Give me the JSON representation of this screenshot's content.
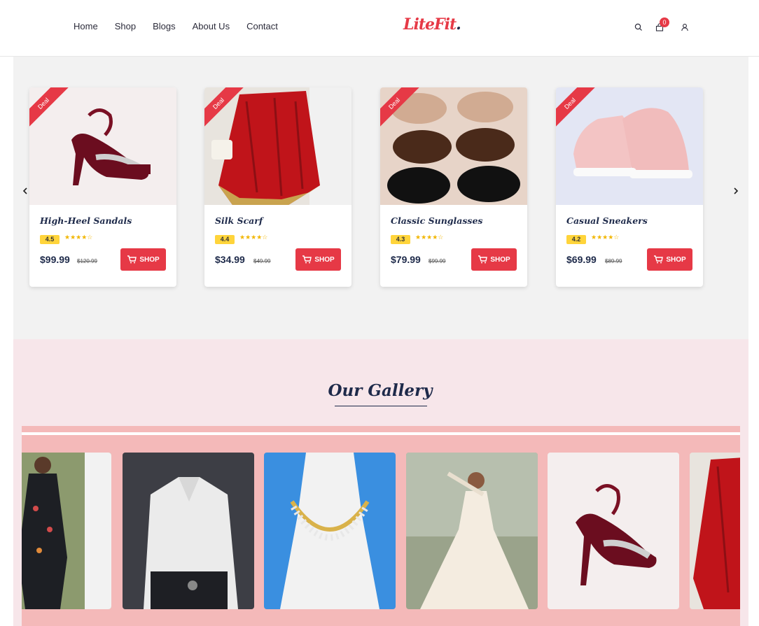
{
  "nav": {
    "items": [
      "Home",
      "Shop",
      "Blogs",
      "About Us",
      "Contact"
    ]
  },
  "logo": {
    "text": "LiteFit",
    "dot": "."
  },
  "header_icons": [
    "search-icon",
    "cart-icon",
    "user-icon"
  ],
  "cart": {
    "count": "0"
  },
  "products": [
    {
      "name": "High-Heel Sandals",
      "rating": "4.5",
      "stars": "★★★★☆",
      "price": "$99.99",
      "old_price": "$120.99",
      "ribbon": "Deal",
      "button": "SHOP"
    },
    {
      "name": "Silk Scarf",
      "rating": "4.4",
      "stars": "★★★★☆",
      "price": "$34.99",
      "old_price": "$49.99",
      "ribbon": "Deal",
      "button": "SHOP"
    },
    {
      "name": "Classic Sunglasses",
      "rating": "4.3",
      "stars": "★★★★☆",
      "price": "$79.99",
      "old_price": "$99.99",
      "ribbon": "Deal",
      "button": "SHOP"
    },
    {
      "name": "Casual Sneakers",
      "rating": "4.2",
      "stars": "★★★★☆",
      "price": "$69.99",
      "old_price": "$89.99",
      "ribbon": "Deal",
      "button": "SHOP"
    }
  ],
  "gallery": {
    "title": "Our Gallery"
  },
  "colors": {
    "accent": "#e63946",
    "navy": "#1e2a4a",
    "rating_bg": "#ffd43b",
    "gallery_bg": "#f7e6ea",
    "gallery_strip": "#f4b9b9"
  }
}
